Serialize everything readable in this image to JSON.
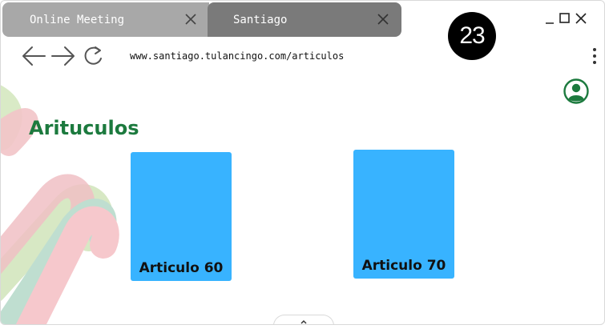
{
  "tabs": [
    {
      "label": "Online Meeting"
    },
    {
      "label": "Santiago"
    }
  ],
  "badge": "23",
  "address_bar": {
    "url": "www.santiago.tulancingo.com/articulos"
  },
  "page": {
    "heading": "Arituculos",
    "cards": [
      {
        "label": "Articulo 60"
      },
      {
        "label": "Articulo 70"
      }
    ]
  },
  "colors": {
    "heading": "#1c7a3e",
    "card": "#38b3ff",
    "tab_inactive": "#a8a8a8",
    "tab_active": "#7a7a7a"
  },
  "icons": [
    "close-icon",
    "minimize-icon",
    "maximize-icon",
    "back-arrow-icon",
    "forward-arrow-icon",
    "reload-icon",
    "more-menu-icon",
    "account-icon",
    "chevron-up-icon"
  ]
}
